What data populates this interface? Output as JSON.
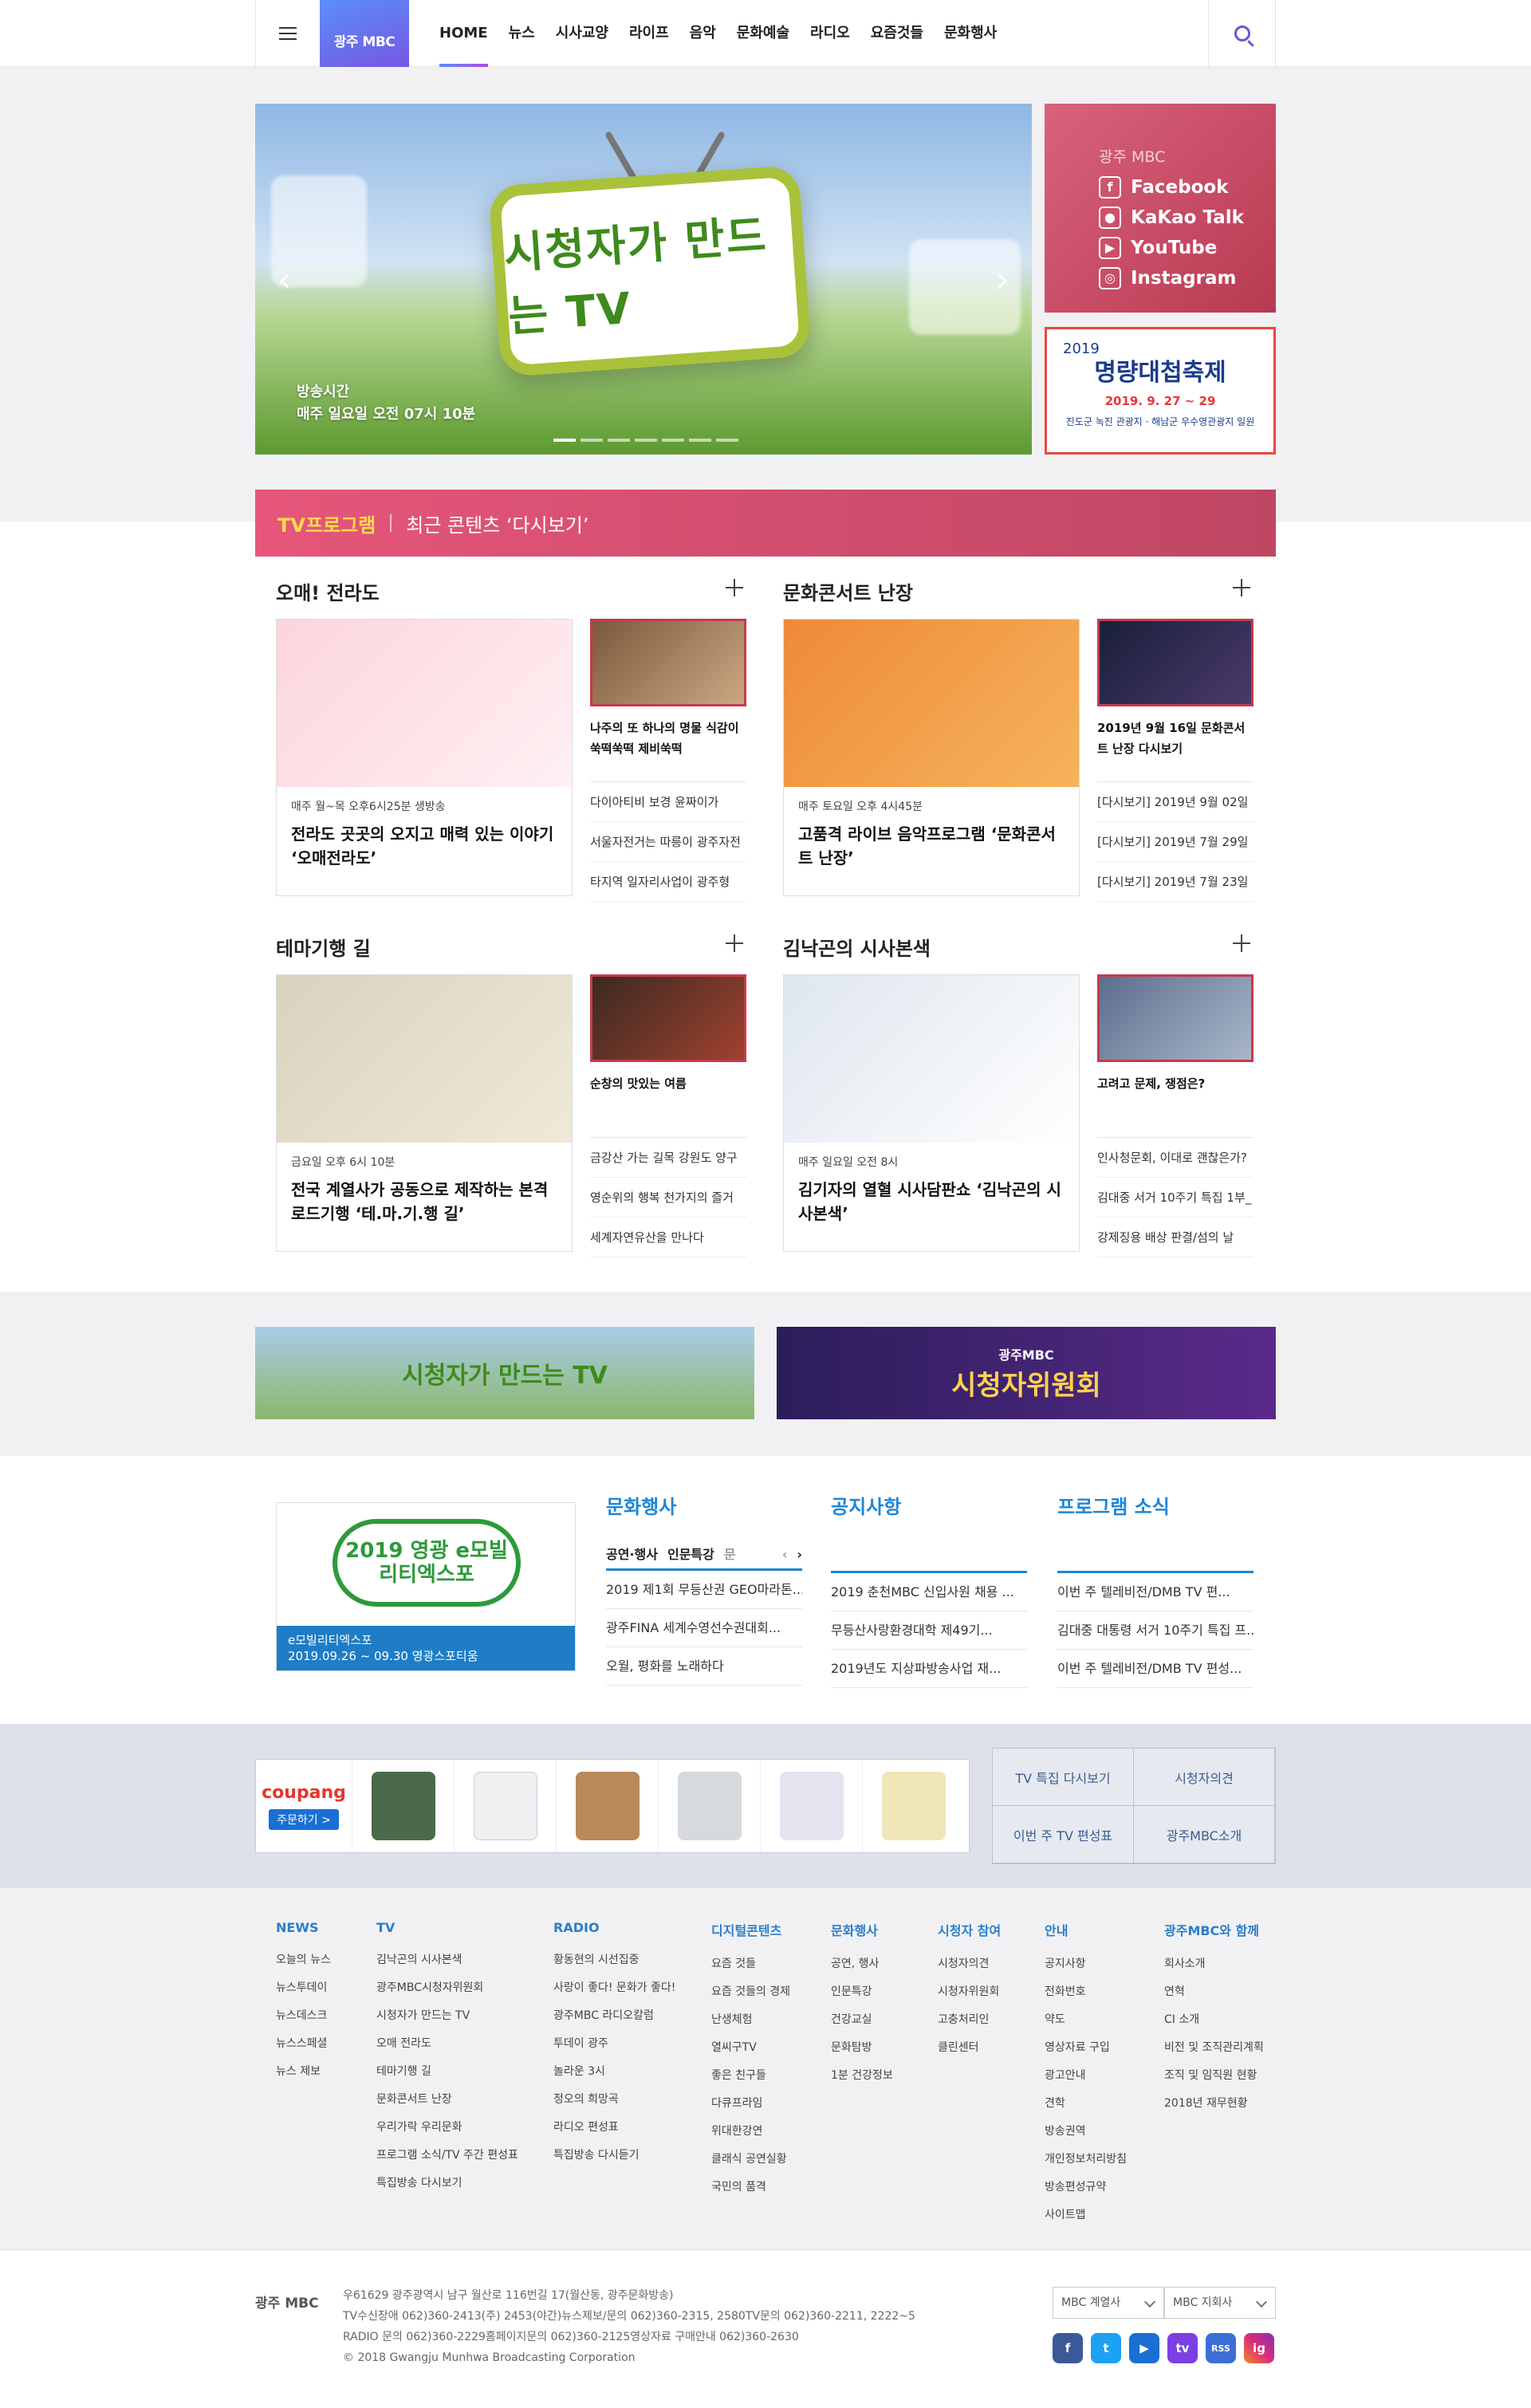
{
  "header": {
    "logo": "광주 MBC",
    "nav": [
      "HOME",
      "뉴스",
      "시사교양",
      "라이프",
      "음악",
      "문화예술",
      "라디오",
      "요즘것들",
      "문화행사"
    ]
  },
  "hero": {
    "title_art": "시청자가 만드는 TV",
    "caption_line1": "방송시간",
    "caption_line2": "매주 일요일 오전 07시 10분",
    "slides": 7,
    "active_slide": 1
  },
  "social": {
    "title": "광주 MBC",
    "links": [
      {
        "label": "Facebook",
        "icon": "facebook-icon"
      },
      {
        "label": "KaKao Talk",
        "icon": "kakao-icon"
      },
      {
        "label": "YouTube",
        "icon": "youtube-icon"
      },
      {
        "label": "Instagram",
        "icon": "instagram-icon"
      }
    ]
  },
  "festival_banner": {
    "year": "2019",
    "title": "명량대첩축제",
    "date": "2019. 9. 27 ~ 29",
    "place": "진도군 녹진 관광지 · 해남군 우수영관광지 일원"
  },
  "tv_bar": {
    "title": "TV프로그램",
    "subtitle": "최근 콘텐츠 ‘다시보기’"
  },
  "programs": [
    {
      "name": "오매! 전라도",
      "schedule": "매주 월~목 오후6시25분 생방송",
      "headline": "전라도 곳곳의 오지고 매력 있는 이야기 ‘오매전라도’",
      "side_title": "나주의 또 하나의 명물 식감이 쑥떡쑥떡 제비쑥떡",
      "side_list": [
        "다이아티비 보경 윤짜이가",
        "서울자전거는 따릉이 광주자전",
        "타지역 일자리사업이 광주형"
      ]
    },
    {
      "name": "문화콘서트 난장",
      "schedule": "매주 토요일 오후 4시45분",
      "headline": "고품격 라이브 음악프로그램 ‘문화콘서트 난장’",
      "side_title": "2019년 9월 16일 문화콘서트 난장 다시보기",
      "side_list": [
        "[다시보기] 2019년 9월 02일",
        "[다시보기] 2019년 7월 29일",
        "[다시보기] 2019년 7월 23일"
      ]
    },
    {
      "name": "테마기행 길",
      "schedule": "금요일 오후 6시 10분",
      "headline": "전국 계열사가 공동으로 제작하는 본격 로드기행 ‘테.마.기.행 길’",
      "side_title": "순창의 맛있는 여름",
      "side_list": [
        "금강산 가는 길목 강원도 양구",
        "영순위의 행복 천가지의 즐거",
        "세계자연유산을 만나다"
      ]
    },
    {
      "name": "김낙곤의 시사본색",
      "schedule": "매주 일요일 오전 8시",
      "headline": "김기자의 열혈 시사담판쇼 ‘김낙곤의 시사본색’",
      "side_title": "고려고 문제, 쟁점은?",
      "side_list": [
        "인사청문회, 이대로 괜찮은가?",
        "김대중 서거 10주기 특집 1부_",
        "강제징용 배상 판결/섬의 날"
      ]
    }
  ],
  "banners": {
    "left": "시청자가 만드는 TV",
    "right_brand": "광주MBC",
    "right": "시청자위원회"
  },
  "event": {
    "image_title": "2019 영광 e모빌리티엑스포",
    "caption_title": "e모빌리티엑스포",
    "caption_date": "2019.09.26 ~ 09.30 영광스포티움"
  },
  "culture": {
    "title": "문화행사",
    "tabs": [
      "공연·행사",
      "인문특강",
      "문"
    ],
    "items": [
      "2019 제1회 무등산권 GEO마라톤...",
      "광주FINA 세계수영선수권대회...",
      "오월, 평화를 노래하다"
    ]
  },
  "notice": {
    "title": "공지사항",
    "items": [
      "2019 춘천MBC 신입사원 채용 ...",
      "무등산사랑환경대학 제49기...",
      "2019년도 지상파방송사업 재..."
    ]
  },
  "program_news": {
    "title": "프로그램 소식",
    "items": [
      "이번 주 텔레비전/DMB TV 편...",
      "김대중 대통령 서거 10주기 특집 프...",
      "이번 주 텔레비전/DMB TV 편성..."
    ]
  },
  "coupang": {
    "brand": "coupang",
    "button": "주문하기 >"
  },
  "quick_links": [
    "TV 특집 다시보기",
    "시청자의견",
    "이번 주 TV 편성표",
    "광주MBC소개"
  ],
  "sitemap": [
    {
      "title": "NEWS",
      "items": [
        "오늘의 뉴스",
        "뉴스투데이",
        "뉴스데스크",
        "뉴스스페셜",
        "뉴스 제보"
      ]
    },
    {
      "title": "TV",
      "items": [
        "김낙곤의 시사본색",
        "광주MBC시청자위원회",
        "시청자가 만드는 TV",
        "오매 전라도",
        "테마기행 길",
        "문화콘서트 난장",
        "우리가락 우리문화",
        "프로그램 소식/TV 주간 편성표",
        "특집방송 다시보기"
      ]
    },
    {
      "title": "RADIO",
      "items": [
        "황동현의 시선집중",
        "사랑이 좋다! 문화가 좋다!",
        "광주MBC 라디오칼럼",
        "투데이 광주",
        "놀라운 3시",
        "정오의 희망곡",
        "라디오 편성표",
        "특집방송 다시듣기"
      ]
    },
    {
      "title": "디지털콘텐츠",
      "items": [
        "요즘 것들",
        "요즘 것들의 경제",
        "난생체험",
        "열씨구TV",
        "좋은 친구들",
        "다큐프라임",
        "위대한강연",
        "클래식 공연실황",
        "국민의 품격"
      ]
    },
    {
      "title": "문화행사",
      "items": [
        "공연, 행사",
        "인문특강",
        "건강교실",
        "문화탐방",
        "1분 건강정보"
      ]
    },
    {
      "title": "시청자 참여",
      "items": [
        "시청자의견",
        "시청자위원회",
        "고충처리인",
        "클린센터"
      ]
    },
    {
      "title": "안내",
      "items": [
        "공지사항",
        "전화번호",
        "약도",
        "영상자료 구입",
        "광고안내",
        "견학",
        "방송권역",
        "개인정보처리방침",
        "방송편성규약",
        "사이트맵"
      ]
    },
    {
      "title": "광주MBC와 함께",
      "items": [
        "회사소개",
        "연혁",
        "CI 소개",
        "비전 및 조직관리계획",
        "조직 및 임직원 현황",
        "2018년 재무현황"
      ]
    }
  ],
  "footer": {
    "logo": "광주 MBC",
    "lines": [
      "우61629 광주광역시 남구 월산로 116번길 17(월산동, 광주문화방송)",
      "TV수신장애 062)360-2413(주) 2453(야간)뉴스제보/문의 062)360-2315, 2580TV문의 062)360-2211, 2222~5",
      "RADIO 문의 062)360-2229홈페이지문의 062)360-2125영상자료 구매안내 062)360-2630",
      "© 2018 Gwangju Munhwa Broadcasting Corporation"
    ],
    "select1": "MBC 계열사",
    "select2": "MBC 지회사",
    "sns": [
      "f",
      "t",
      "▶",
      "tv",
      "RSS",
      "ig"
    ]
  },
  "colors": {
    "accent": "#c7394e",
    "blue": "#1e86d6",
    "brand_gradient": [
      "#5a8ff7",
      "#7b4fe0"
    ]
  }
}
